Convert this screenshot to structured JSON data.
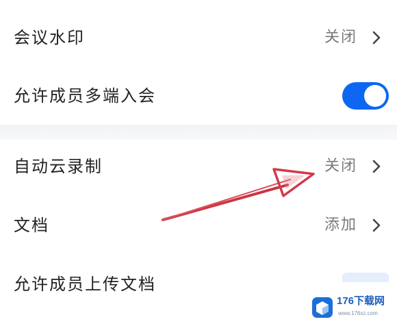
{
  "settings": {
    "group1": [
      {
        "label": "会议水印",
        "value": "关闭",
        "type": "link"
      },
      {
        "label": "允许成员多端入会",
        "type": "toggle",
        "checked": true
      }
    ],
    "group2": [
      {
        "label": "自动云录制",
        "value": "关闭",
        "type": "link"
      },
      {
        "label": "文档",
        "value": "添加",
        "type": "link"
      },
      {
        "label": "允许成员上传文档",
        "type": "toggle"
      }
    ]
  },
  "colors": {
    "toggle_on": "#0d67f2",
    "annotation_arrow": "#d23a4a"
  },
  "icons": {
    "chevron": "chevron-right-icon",
    "annotation": "red-arrow-annotation"
  },
  "watermark": {
    "text": "176下载网",
    "sub": "www.176xz.com"
  }
}
